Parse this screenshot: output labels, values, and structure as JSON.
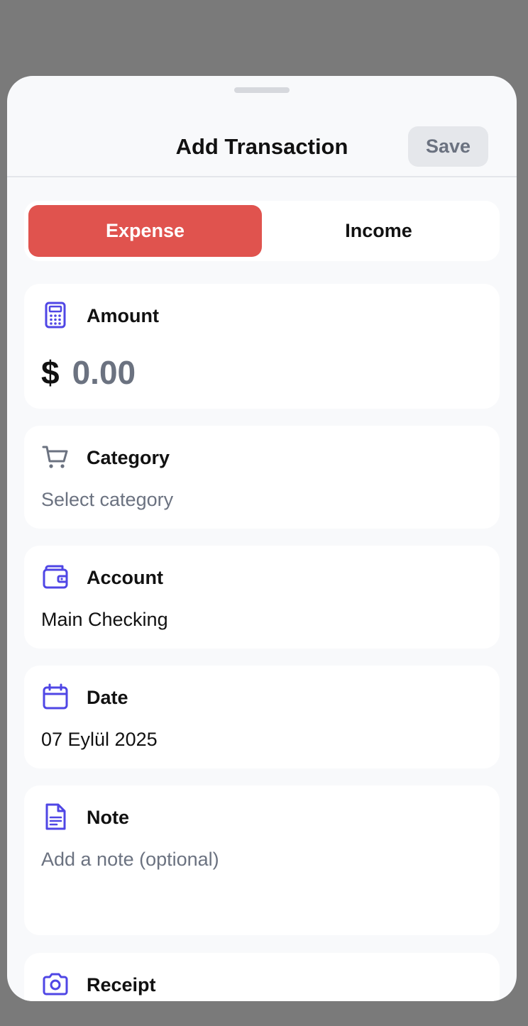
{
  "header": {
    "title": "Add Transaction",
    "save_label": "Save"
  },
  "type_toggle": {
    "expense_label": "Expense",
    "income_label": "Income",
    "selected": "Expense"
  },
  "amount": {
    "label": "Amount",
    "icon": "calculator-icon",
    "currency": "$",
    "value": "0.00"
  },
  "category": {
    "label": "Category",
    "icon": "cart-icon",
    "placeholder": "Select category"
  },
  "account": {
    "label": "Account",
    "icon": "wallet-icon",
    "value": "Main Checking"
  },
  "date": {
    "label": "Date",
    "icon": "calendar-icon",
    "value": "07 Eylül 2025"
  },
  "note": {
    "label": "Note",
    "icon": "document-icon",
    "placeholder": "Add a note (optional)"
  },
  "receipt": {
    "label": "Receipt",
    "icon": "camera-icon"
  },
  "colors": {
    "accent": "#4f46e5",
    "expense": "#e0534e",
    "muted": "#6b7280"
  }
}
